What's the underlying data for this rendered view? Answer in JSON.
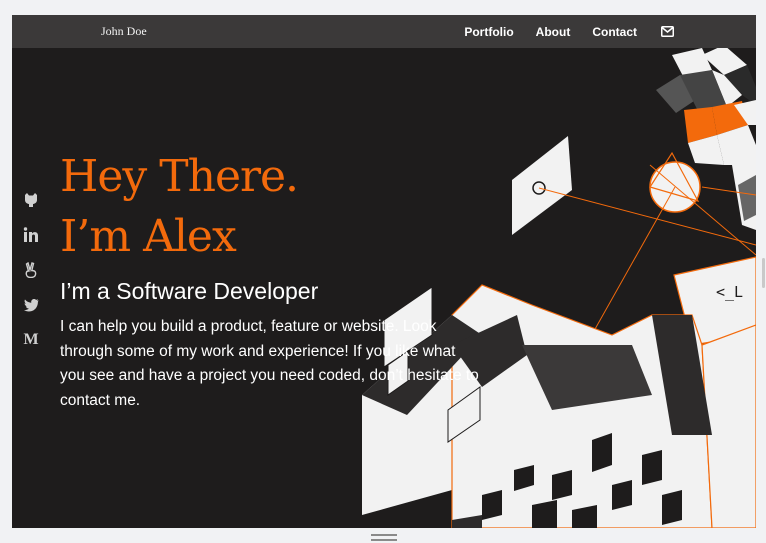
{
  "header": {
    "brand": "John Doe",
    "nav": [
      {
        "label": "Portfolio"
      },
      {
        "label": "About"
      },
      {
        "label": "Contact"
      }
    ],
    "mail_icon": "envelope-icon"
  },
  "social": [
    {
      "icon": "github-icon"
    },
    {
      "icon": "linkedin-icon"
    },
    {
      "icon": "angellist-icon"
    },
    {
      "icon": "twitter-icon"
    },
    {
      "icon": "medium-icon",
      "glyph": "M"
    }
  ],
  "hero": {
    "line1": "Hey There.",
    "line2": "I’m Alex",
    "subtitle": "I’m a Software Developer",
    "body": "I can help you build a product, feature or website. Look through some of my work and experience! If you like what you see and have a project you need coded, don’t hesitate to contact me."
  },
  "colors": {
    "accent": "#f36a0c",
    "background": "#1e1c1c",
    "topbar": "#3b3939",
    "text": "#ffffff"
  },
  "art": {
    "code_glyph": "<_L"
  }
}
